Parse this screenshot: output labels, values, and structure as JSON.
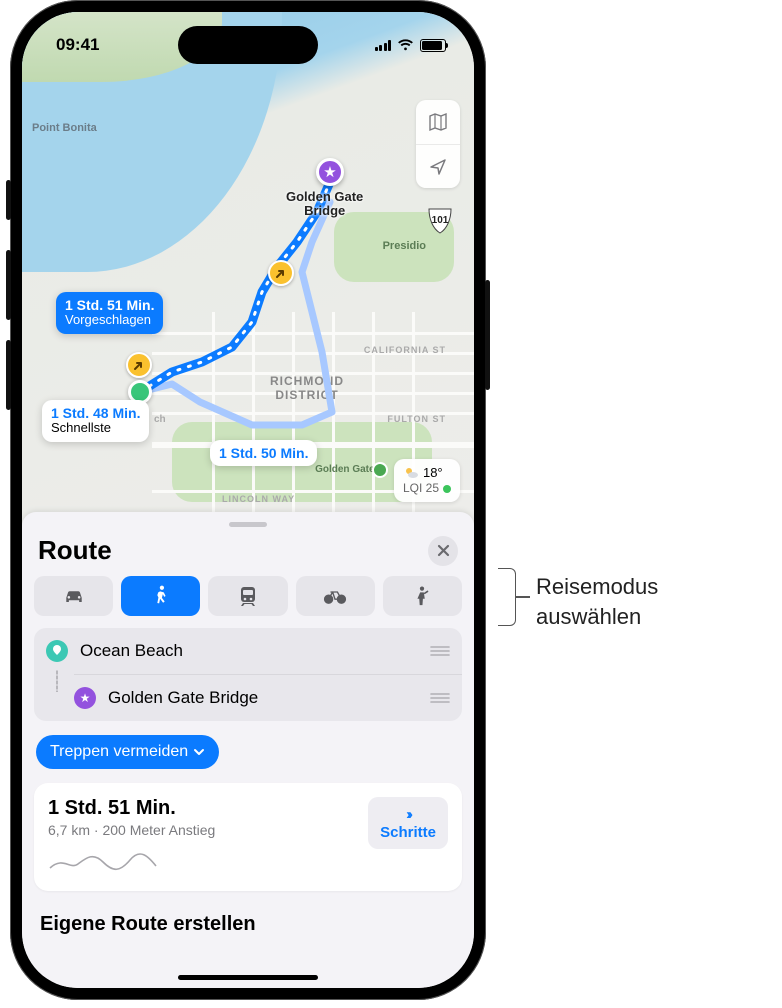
{
  "status": {
    "time": "09:41"
  },
  "map": {
    "labels": {
      "bonita": "Point Bonita",
      "presidio": "Presidio",
      "richmond_l1": "RICHMOND",
      "richmond_l2": "DISTRICT",
      "california": "CALIFORNIA ST",
      "fulton": "FULTON ST",
      "ggpark": "Golden Gate P",
      "lincoln": "LINCOLN WAY",
      "ch": "ch",
      "hwy101": "101"
    },
    "destination": {
      "name_l1": "Golden Gate",
      "name_l2": "Bridge"
    },
    "routes": {
      "suggested": {
        "time": "1 Std. 51 Min.",
        "tag": "Vorgeschlagen"
      },
      "fastest": {
        "time": "1 Std. 48 Min.",
        "tag": "Schnellste"
      },
      "alt": {
        "time": "1 Std. 50 Min."
      }
    },
    "weather": {
      "temp": "18°",
      "aqi_label": "LQI 25"
    }
  },
  "sheet": {
    "title": "Route",
    "modes": [
      "car",
      "walk",
      "transit",
      "bike",
      "rideshare"
    ],
    "selected_mode": "walk",
    "waypoints": {
      "start": "Ocean Beach",
      "end": "Golden Gate Bridge"
    },
    "avoid_label": "Treppen vermeiden",
    "route_card": {
      "duration": "1 Std. 51 Min.",
      "distance": "6,7 km",
      "ascent": "200 Meter Anstieg",
      "steps_btn": "Schritte"
    },
    "create_route": "Eigene Route erstellen"
  },
  "callout": {
    "line1": "Reisemodus",
    "line2": "auswählen"
  }
}
